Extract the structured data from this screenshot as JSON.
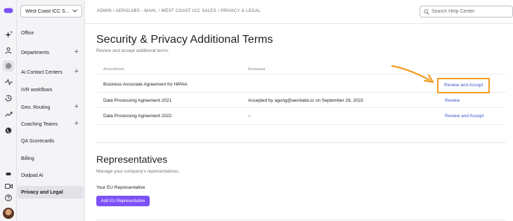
{
  "rail": {
    "icons": [
      "logo-icon",
      "sparkle-icon",
      "person-icon",
      "gear-icon",
      "activity-icon",
      "history-icon",
      "trending-icon",
      "globe-icon",
      "phone-icon",
      "video-icon",
      "help-icon"
    ]
  },
  "sidebar": {
    "org_selector": "West Coast ICC S...",
    "items": [
      {
        "label": "Office",
        "expandable": false
      },
      {
        "label": "Departments",
        "expandable": true
      },
      {
        "label": "Ai Contact Centers",
        "expandable": true
      },
      {
        "label": "IVR workflows",
        "expandable": false
      },
      {
        "label": "Geo. Routing",
        "expandable": true
      },
      {
        "label": "Coaching Teams",
        "expandable": true
      },
      {
        "label": "QA Scorecards",
        "expandable": false
      },
      {
        "label": "Billing",
        "expandable": false
      },
      {
        "label": "Dialpad Ai",
        "expandable": false
      },
      {
        "label": "Privacy and Legal",
        "expandable": false,
        "active": true
      }
    ]
  },
  "header": {
    "breadcrumb": "ADMIN / AEROLABS - MAIN. / WEST COAST ICC SALES / PRIVACY & LEGAL",
    "search_placeholder": "Search Help Center"
  },
  "security": {
    "title": "Security & Privacy Additional Terms",
    "subtitle": "Review and accept additional terms",
    "columns": [
      "Amendment",
      "Reviewed"
    ],
    "rows": [
      {
        "amendment": "Business Associate Agreement for HIPAA",
        "reviewed": "",
        "action": "Review and Accept"
      },
      {
        "amendment": "Data Processing Agreement 2021",
        "reviewed": "Accepted by agung@aerolabs.io on September 29, 2023",
        "action": "Review"
      },
      {
        "amendment": "Data Processing Agreement 2022",
        "reviewed": "–",
        "action": "Review and Accept"
      }
    ]
  },
  "representatives": {
    "title": "Representatives",
    "subtitle": "Manage your company's representatives",
    "eu_label": "Your EU Representative",
    "add_button": "Add EU Representative"
  },
  "colors": {
    "accent": "#7c52f6",
    "link": "#3d55c9",
    "annotation": "#f39b21"
  }
}
